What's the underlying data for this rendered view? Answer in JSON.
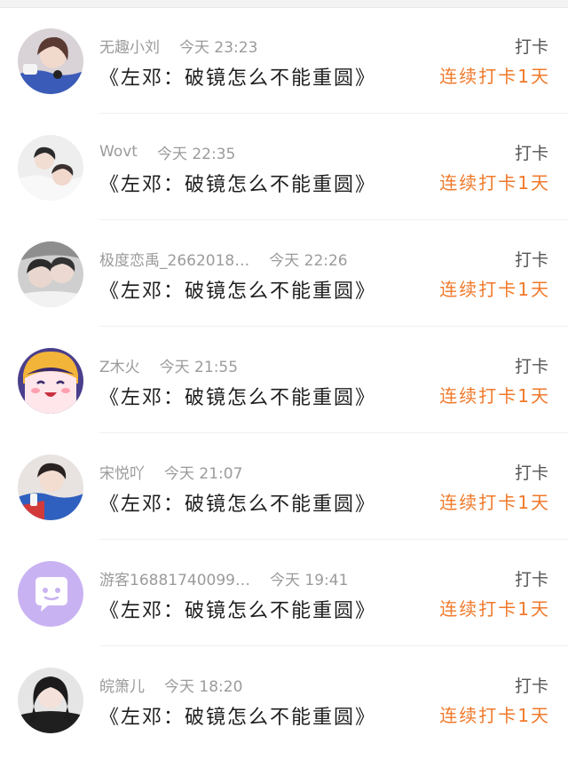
{
  "checkins": [
    {
      "username": "无趣小刘",
      "time": "今天 23:23",
      "book": "《左邓：破镜怎么不能重圆》",
      "action": "打卡",
      "streak": "连续打卡1天",
      "avatar": "photo-avatar"
    },
    {
      "username": "Wovt",
      "time": "今天 22:35",
      "book": "《左邓：破镜怎么不能重圆》",
      "action": "打卡",
      "streak": "连续打卡1天",
      "avatar": "photo-avatar"
    },
    {
      "username": "极度恋禹_2662018…",
      "time": "今天 22:26",
      "book": "《左邓：破镜怎么不能重圆》",
      "action": "打卡",
      "streak": "连续打卡1天",
      "avatar": "photo-avatar"
    },
    {
      "username": "Z木火",
      "time": "今天 21:55",
      "book": "《左邓：破镜怎么不能重圆》",
      "action": "打卡",
      "streak": "连续打卡1天",
      "avatar": "cartoon-avatar"
    },
    {
      "username": "宋悦吖",
      "time": "今天 21:07",
      "book": "《左邓：破镜怎么不能重圆》",
      "action": "打卡",
      "streak": "连续打卡1天",
      "avatar": "photo-avatar"
    },
    {
      "username": "游客16881740099…",
      "time": "今天 19:41",
      "book": "《左邓：破镜怎么不能重圆》",
      "action": "打卡",
      "streak": "连续打卡1天",
      "avatar": "default-chat-avatar"
    },
    {
      "username": "皖箫儿",
      "time": "今天 18:20",
      "book": "《左邓：破镜怎么不能重圆》",
      "action": "打卡",
      "streak": "连续打卡1天",
      "avatar": "photo-avatar"
    }
  ],
  "colors": {
    "streak": "#f0792a",
    "meta": "#9b9b9b",
    "title": "#1e1e1e",
    "default_avatar_bg": "#c9b2f2"
  }
}
